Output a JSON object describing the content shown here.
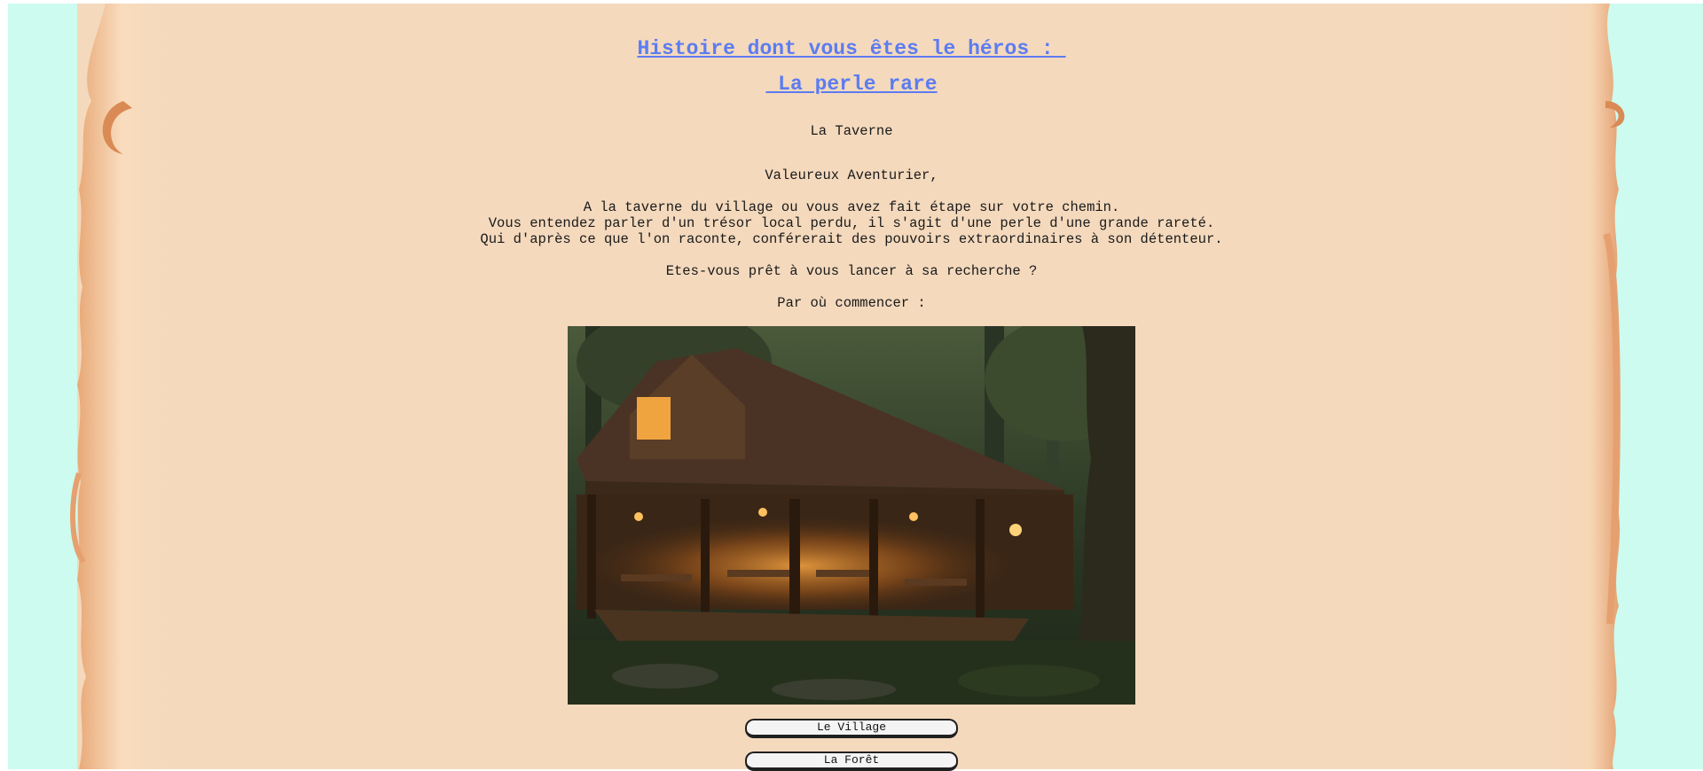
{
  "colors": {
    "outside_background": "#cdfbef",
    "parchment": "#f4d9bd",
    "title": "#5c7cf0",
    "text": "#1a1a1a"
  },
  "header": {
    "title_line1": "Histoire dont vous êtes le héros : ",
    "title_line2": " La perle rare"
  },
  "chapter": {
    "name": "La Taverne"
  },
  "story": {
    "greeting": "Valeureux Aventurier,",
    "paragraph_lines": [
      "A la taverne du village ou vous avez fait étape sur votre chemin.",
      "Vous entendez parler d'un trésor local perdu, il s'agit d'une perle d'une grande rareté.",
      "Qui d'après ce que l'on raconte, conférerait des pouvoirs extraordinaires à son détenteur."
    ],
    "question": "Etes-vous prêt à vous lancer à sa recherche ?",
    "prompt": "Par où commencer :"
  },
  "image": {
    "subject": "tavern-in-forest-illustration"
  },
  "choices": [
    {
      "label": "Le Village"
    },
    {
      "label": "La Forêt"
    }
  ]
}
